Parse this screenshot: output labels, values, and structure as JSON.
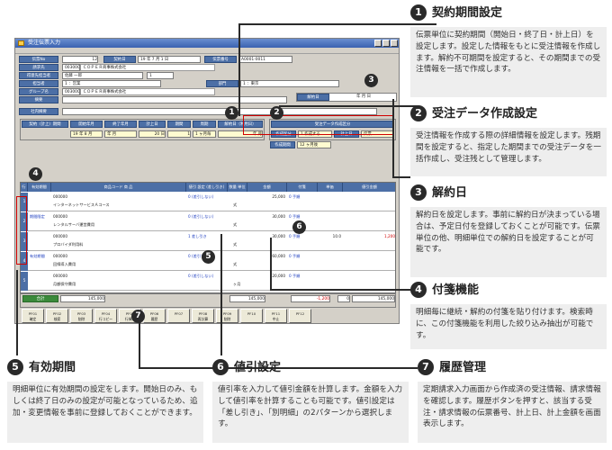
{
  "window": {
    "title": "受注伝票入力",
    "header_labels": [
      "伝票No",
      "請求先",
      "得意先担当者",
      "担当者",
      "グループ名",
      "摘要",
      "社内摘要"
    ],
    "header_values": [
      "12",
      "契約日",
      "19 年 7 月 1 日",
      "伝票番号",
      "A0001-0011",
      "003000",
      "ＣＯＰＥＲ商事株式会社",
      "佐藤 一郎",
      "1",
      "1 ：営業",
      "部門",
      "1 ：東京",
      "003000",
      "ＣＯＰＥＲ商事株式会社"
    ],
    "period_labels": [
      "契約（計上）期間",
      "開始年月",
      "終了年月",
      "計上日",
      "期間",
      "周期",
      "解約日（利用日）"
    ],
    "period_values": [
      "19 年 8 月",
      "年 月",
      "20 日",
      "1",
      "1 ヶ月毎",
      "年 月"
    ],
    "cancel": {
      "label": "解約日",
      "value": "年 月 日"
    },
    "detail_labels": [
      "受注データ作成区分",
      "作成区分",
      "作成期間"
    ],
    "detail_values": [
      "1 作成する",
      "計上日",
      "伝票",
      "12 ヶ月後"
    ],
    "grid_headers": [
      "行",
      "有効期間",
      "商品コード 商 品",
      "値引 設定 (差し引き)",
      "数量 単位",
      "金額",
      "付箋",
      "単価",
      "値引金額"
    ],
    "rows": [
      {
        "no": "1",
        "code": "000000",
        "name": "インターネットサービスＡコース",
        "disc": "0 (差引しない)",
        "unit": "式",
        "amount": "25,000",
        "tag": "0 手順"
      },
      {
        "no": "2",
        "code": "000000",
        "name": "レンタルサーバ運営費用",
        "valid": "期間限定",
        "disc": "0 (差引しない)",
        "unit": "式",
        "amount": "30,000",
        "tag": "0 手順"
      },
      {
        "no": "3",
        "code": "000000",
        "name": "プロバイダ利用料",
        "disc": "1 差し引き",
        "unit": "式",
        "amount": "30,000",
        "tag": "0 手順",
        "rate": "10.0",
        "discamt": "1,200"
      },
      {
        "no": "4",
        "code": "000000",
        "name": "回線導入費用",
        "valid": "有効期間",
        "disc": "0 (差引しない)",
        "unit": "式",
        "amount": "60,000",
        "tag": "0 手順"
      },
      {
        "no": "5",
        "code": "000000",
        "name": "月額保守費用",
        "disc": "0 (差引しない)",
        "unit": "ヶ月",
        "amount": "20,000",
        "tag": "0 手順"
      }
    ],
    "totals": {
      "label": "合計",
      "subtotal": "145,000",
      "discount": "-1,200",
      "tax": "0",
      "total": "145,000"
    },
    "fkeys": [
      "PF01\n確定",
      "PF02\n検索",
      "PF03\n削除",
      "PF04\n行コピー",
      "PF05\n行挿入",
      "PF06\n履歴",
      "PF07",
      "PF08\n再計算",
      "PF09\n削除",
      "PF10",
      "PF11\n中止",
      "PF12"
    ]
  },
  "sections": [
    {
      "num": "1",
      "title": "契約期間設定",
      "body": "伝票単位に契約期間（開始日・終了日・計上日）を設定します。設定した情報をもとに受注情報を作成します。解約不可期間を設定すると、その期間までの受注情報を一括で作成します。"
    },
    {
      "num": "2",
      "title": "受注データ作成設定",
      "body": "受注情報を作成する際の詳細情報を設定します。残期間を設定すると、指定した期間までの受注データを一括作成し、受注残として管理します。"
    },
    {
      "num": "3",
      "title": "解約日",
      "body": "解約日を設定します。事前に解約日が決まっている場合は、予定日付を登録しておくことが可能です。伝票単位の他、明細単位での解約日を設定することが可能です。"
    },
    {
      "num": "4",
      "title": "付箋機能",
      "body": "明細毎に継続・解約の付箋を貼り付けます。検索時に、この付箋機能を利用した絞り込み抽出が可能です。"
    },
    {
      "num": "5",
      "title": "有効期間",
      "body": "明細単位に有効期間の設定をします。開始日のみ、もしくは終了日のみの設定が可能となっているため、追加・変更情報を事前に登録しておくことができます。"
    },
    {
      "num": "6",
      "title": "値引設定",
      "body": "値引率を入力して値引金額を計算します。金額を入力して値引率を計算することも可能です。値引設定は「差し引き」、「別明細」の2パターンから選択します。"
    },
    {
      "num": "7",
      "title": "履歴管理",
      "body": "定期請求入力画面から作成済の受注情報、請求情報を確認します。履歴ボタンを押すと、該当する受注・請求情報の伝票番号、計上日、計上金額を画面表示します。"
    }
  ]
}
